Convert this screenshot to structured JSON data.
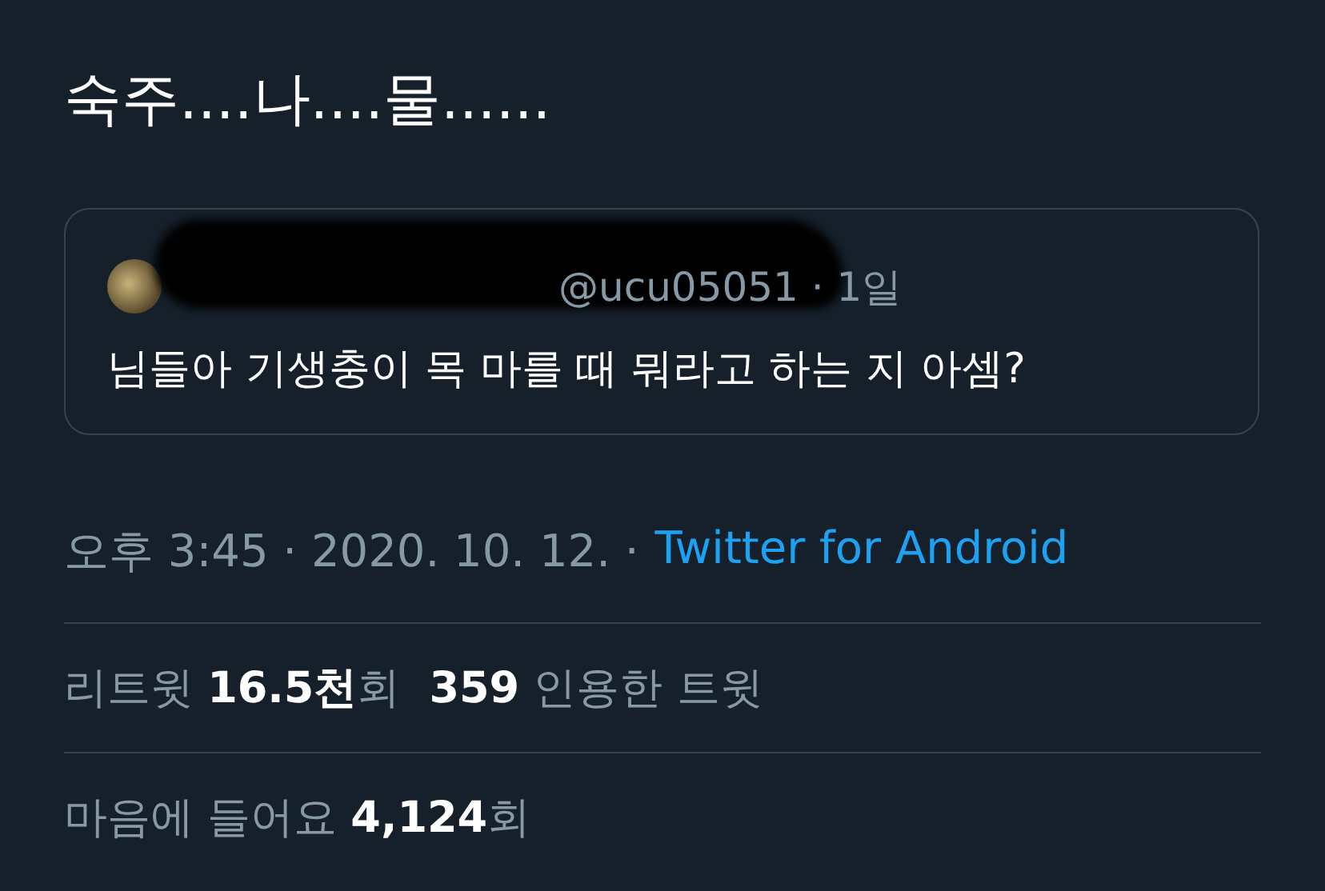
{
  "tweet": {
    "text": "숙주....나....물......",
    "quoted": {
      "handle": "@ucu05051",
      "separator": "·",
      "time": "1일",
      "text": "님들아 기생충이 목 마를 때 뭐라고 하는 지 아셈?"
    },
    "time": "오후 3:45 · 2020. 10. 12. ·",
    "source": "Twitter for Android",
    "stats": [
      {
        "items": [
          {
            "label": "리트윗",
            "value": "16.5천",
            "unit": "회"
          },
          {
            "label": "인용한 트윗",
            "value": "359"
          }
        ]
      },
      {
        "items": [
          {
            "label": "마음에 들어요",
            "value": "4,124",
            "unit": "회"
          }
        ]
      }
    ]
  }
}
